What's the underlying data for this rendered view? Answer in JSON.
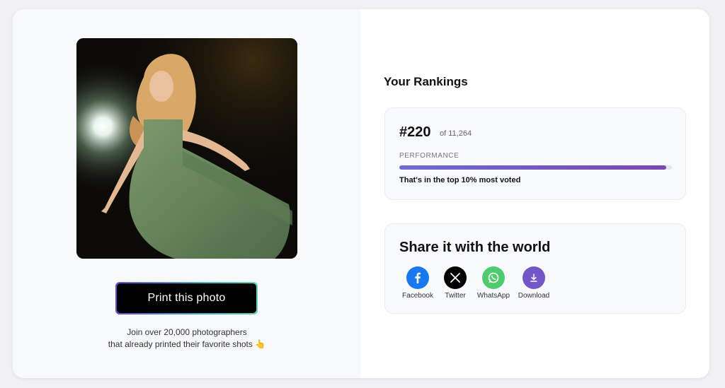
{
  "print": {
    "button_label": "Print this photo",
    "join_line1": "Join over 20,000 photographers",
    "join_line2": "that already printed their favorite shots",
    "emoji": "👆"
  },
  "rankings": {
    "title": "Your Rankings",
    "rank": "#220",
    "of_total": "of 11,264",
    "performance_label": "PERFORMANCE",
    "performance_fraction": 0.98,
    "summary": "That's in the top 10% most voted"
  },
  "share": {
    "title": "Share it with the world",
    "items": [
      {
        "label": "Facebook",
        "icon": "facebook-icon",
        "color": "#1877f2"
      },
      {
        "label": "Twitter",
        "icon": "x-icon",
        "color": "#000000"
      },
      {
        "label": "WhatsApp",
        "icon": "whatsapp-icon",
        "color": "#4ecb6c"
      },
      {
        "label": "Download",
        "icon": "download-icon",
        "color": "#7357c9"
      }
    ]
  }
}
